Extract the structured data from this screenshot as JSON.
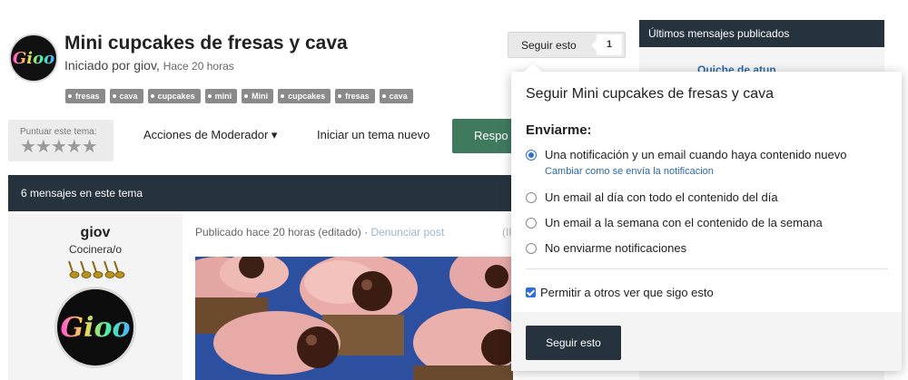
{
  "header": {
    "avatar_text": "Gioo",
    "title": "Mini cupcakes de fresas y cava",
    "started_by": "Iniciado por giov,",
    "time": "Hace 20 horas",
    "tags": [
      "fresas",
      "cava",
      "cupcakes",
      "mini",
      "Mini",
      "cupcakes",
      "fresas",
      "cava"
    ]
  },
  "follow": {
    "label": "Seguir esto",
    "count": "1"
  },
  "actions": {
    "rate_label": "Puntuar este tema:",
    "stars": "★★★★★",
    "moderator": "Acciones de Moderador ▾",
    "new_topic": "Iniciar un tema nuevo",
    "reply": "Respo"
  },
  "posts": {
    "count_label": "6 mensajes en este tema",
    "author": {
      "name": "giov",
      "rank": "Cocinera/o",
      "avatar_text": "Gioo"
    },
    "meta": "Publicado hace 20 horas (editado) · ",
    "report": "Denunciar post",
    "ip": "(IP"
  },
  "sidebar": {
    "title": "Últimos mensajes publicados",
    "first_item": "Quiche de atun"
  },
  "popup": {
    "title": "Seguir Mini cupcakes de fresas y cava",
    "subtitle": "Enviarme:",
    "options": [
      "Una notificación y un email cuando haya contenido nuevo",
      "Un email al día con todo el contenido del día",
      "Un email a la semana con el contenido de la semana",
      "No enviarme notificaciones"
    ],
    "change_link": "Cambiar como se envía la notificacion",
    "allow_label": "Permitir a otros ver que sigo esto",
    "submit": "Seguir esto"
  },
  "colors": {
    "dark_bar": "#26333f",
    "reply_green": "#3f7a5f",
    "accent_blue": "#2d6fd6"
  }
}
